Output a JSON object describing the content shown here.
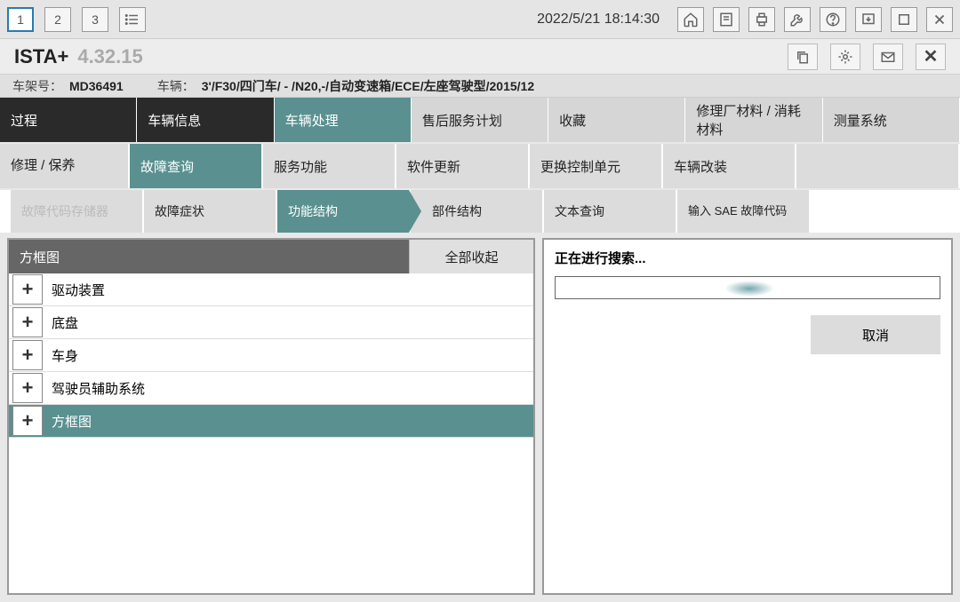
{
  "toolbar": {
    "workspaces": [
      "1",
      "2",
      "3"
    ],
    "datetime": "2022/5/21 18:14:30"
  },
  "app": {
    "name": "ISTA+",
    "version": "4.32.15"
  },
  "vehicle": {
    "vin_label": "车架号：",
    "vin": "MD36491",
    "vehicle_label": "车辆：",
    "vehicle_desc": "3'/F30/四门车/ - /N20,-/自动变速箱/ECE/左座驾驶型/2015/12"
  },
  "main_tabs": [
    {
      "label": "过程",
      "style": "dark"
    },
    {
      "label": "车辆信息",
      "style": "dark"
    },
    {
      "label": "车辆处理",
      "style": "teal"
    },
    {
      "label": "售后服务计划",
      "style": "default"
    },
    {
      "label": "收藏",
      "style": "default"
    },
    {
      "label": "修理厂材料 / 消耗材料",
      "style": "default"
    },
    {
      "label": "测量系统",
      "style": "default"
    }
  ],
  "sub_tabs1": [
    {
      "label": "修理 / 保养",
      "style": "default"
    },
    {
      "label": "故障查询",
      "style": "teal"
    },
    {
      "label": "服务功能",
      "style": "default"
    },
    {
      "label": "软件更新",
      "style": "default"
    },
    {
      "label": "更换控制单元",
      "style": "default"
    },
    {
      "label": "车辆改装",
      "style": "default"
    }
  ],
  "sub_tabs2": [
    {
      "label": "故障代码存储器",
      "disabled": true
    },
    {
      "label": "故障症状"
    },
    {
      "label": "功能结构",
      "style": "teal"
    },
    {
      "label": "部件结构"
    },
    {
      "label": "文本查询"
    },
    {
      "label": "输入 SAE 故障代码"
    }
  ],
  "left_panel": {
    "title": "方框图",
    "collapse_all": "全部收起",
    "items": [
      {
        "label": "驱动装置"
      },
      {
        "label": "底盘"
      },
      {
        "label": "车身"
      },
      {
        "label": "驾驶员辅助系统"
      },
      {
        "label": "方框图",
        "selected": true
      }
    ]
  },
  "right_panel": {
    "status": "正在进行搜索...",
    "cancel": "取消"
  }
}
